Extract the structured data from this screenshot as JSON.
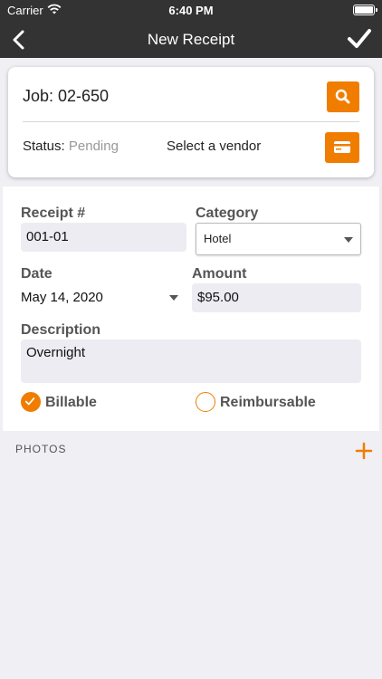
{
  "status_bar": {
    "carrier": "Carrier",
    "time": "6:40 PM"
  },
  "nav": {
    "title": "New Receipt",
    "back_icon": "chevron-left-icon",
    "done_icon": "checkmark-icon"
  },
  "job": {
    "label": "Job: 02-650",
    "status_prefix": "Status:",
    "status_value": "Pending",
    "vendor_placeholder": "Select a vendor"
  },
  "form": {
    "receipt_label": "Receipt #",
    "receipt_value": "001-01",
    "category_label": "Category",
    "category_value": "Hotel",
    "date_label": "Date",
    "date_value": "May 14, 2020",
    "amount_label": "Amount",
    "amount_value": "$95.00",
    "description_label": "Description",
    "description_value": "Overnight",
    "billable_label": "Billable",
    "billable_checked": true,
    "reimbursable_label": "Reimbursable",
    "reimbursable_checked": false
  },
  "photos": {
    "label": "PHOTOS"
  },
  "colors": {
    "accent": "#f07d00",
    "navbar": "#333333",
    "background": "#efeff4"
  }
}
